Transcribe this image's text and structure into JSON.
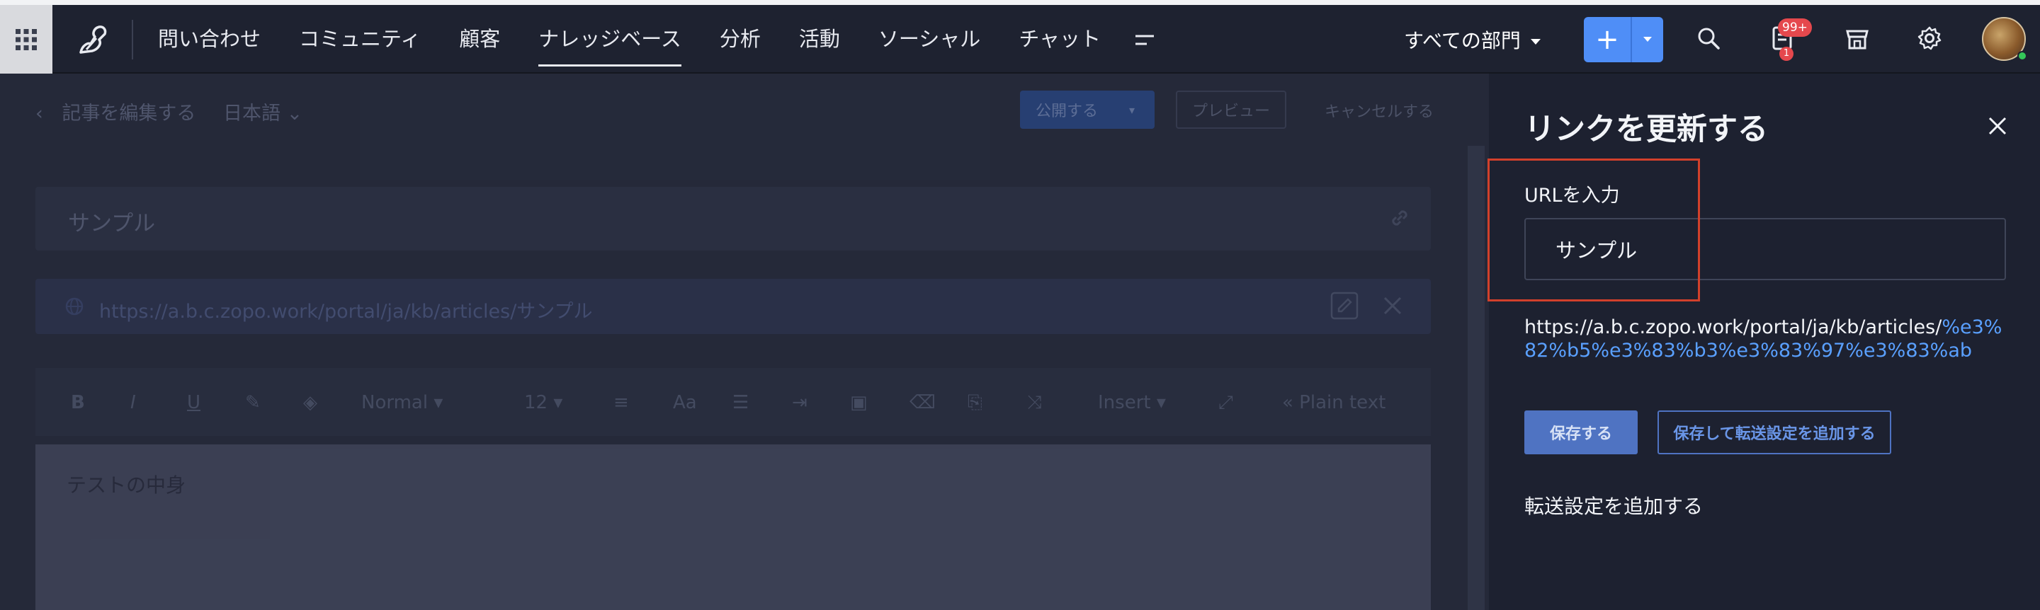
{
  "nav": {
    "tabs": [
      "問い合わせ",
      "コミュニティ",
      "顧客",
      "ナレッジベース",
      "分析",
      "活動",
      "ソーシャル",
      "チャット"
    ],
    "active_tab": "ナレッジベース",
    "department": "すべての部門",
    "add_label": "+",
    "notifications_badge": "99+",
    "tasks_badge": "1",
    "icons": [
      "apps-grid-icon",
      "logo-icon",
      "more-icon",
      "search-icon",
      "notifications-icon",
      "marketplace-icon",
      "gear-icon",
      "avatar"
    ]
  },
  "editor": {
    "header_title": "記事を編集する",
    "language": "日本語",
    "publish_label": "公開する",
    "preview_label": "プレビュー",
    "cancel_label": "キャンセルする",
    "article_title": "サンプル",
    "article_url": "https://a.b.c.zopo.work/portal/ja/kb/articles/サンプル",
    "toolbar": {
      "format": "Normal",
      "font_size": "12",
      "insert": "Insert",
      "plain_text": "« Plain text"
    },
    "body_text": "テストの中身"
  },
  "panel": {
    "title": "リンクを更新する",
    "url_label": "URLを入力",
    "url_value": "サンプル",
    "full_url_base": "https://a.b.c.zopo.work/portal/ja/kb/articles/",
    "full_url_encoded": "%e3%82%b5%e3%83%b3%e3%83%97%e3%83%ab",
    "save_label": "保存する",
    "save_redirect_label": "保存して転送設定を追加する",
    "add_redirect_label": "転送設定を追加する"
  },
  "colors": {
    "accent": "#4f8ef7",
    "badge": "#e5484d",
    "highlight": "#d2402b",
    "link": "#5aa0ff"
  }
}
